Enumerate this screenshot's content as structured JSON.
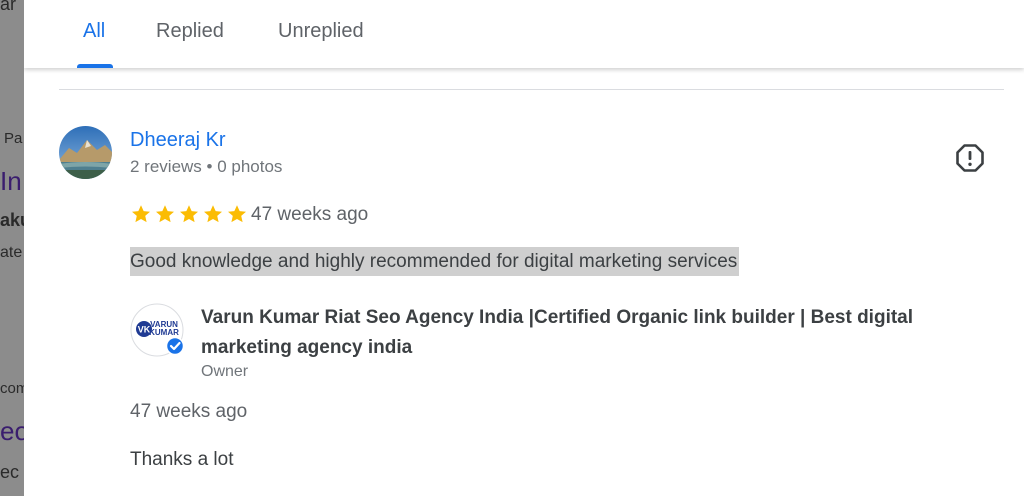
{
  "background_fragments": [
    {
      "id": "frag-1",
      "text": "ar"
    },
    {
      "id": "frag-2",
      "text": "Pa"
    },
    {
      "id": "frag-3",
      "text": "In"
    },
    {
      "id": "frag-4",
      "text": "aku"
    },
    {
      "id": "frag-5",
      "text": "ate"
    },
    {
      "id": "frag-6",
      "text": "com"
    },
    {
      "id": "frag-7",
      "text": "eo"
    },
    {
      "id": "frag-8",
      "text": "ec"
    }
  ],
  "tabs": {
    "all": "All",
    "replied": "Replied",
    "unreplied": "Unreplied",
    "active": "All"
  },
  "review": {
    "reviewer_name": "Dheeraj Kr",
    "reviewer_meta": "2 reviews • 0 photos",
    "rating": 5,
    "time": "47 weeks ago",
    "text": "Good knowledge and highly recommended for digital marketing services",
    "star_color": "#fbbc04"
  },
  "owner_reply": {
    "logo_text_top": "VARUN",
    "logo_text_bottom": "KUMAR",
    "logo_initials": "VK",
    "owner_name": "Varun Kumar Riat Seo Agency India |Certified Organic link builder | Best digital marketing agency india",
    "owner_label": "Owner",
    "time": "47 weeks ago",
    "text": "Thanks a lot"
  },
  "icons": {
    "report": "report-flag-octagon-icon",
    "verified": "verified-check-icon"
  },
  "colors": {
    "accent": "#1a73e8",
    "highlight": "#cfcfcf"
  }
}
